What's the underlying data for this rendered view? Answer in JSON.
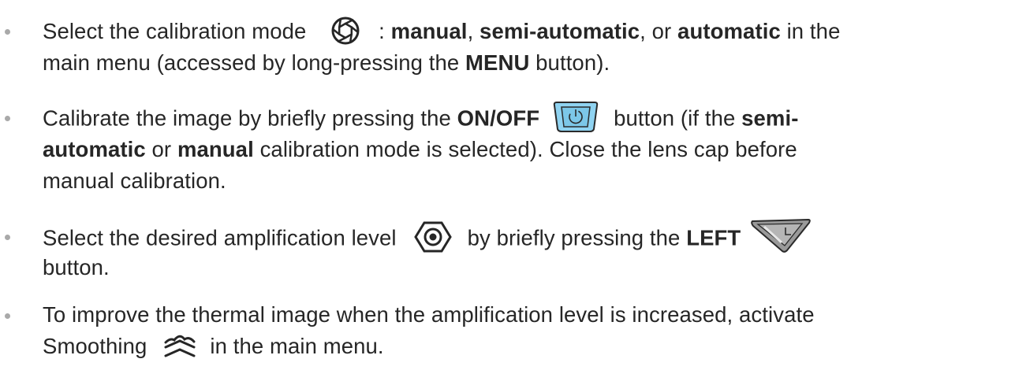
{
  "instructions": {
    "item1": {
      "t1": "Select the ",
      "t2": "calibration mode",
      "t3": " : ",
      "t4": "manual",
      "t5": ", ",
      "t6": "semi-automatic",
      "t7": ", or ",
      "t8": "automatic",
      "t9": " in the",
      "t10": "main menu (accessed by long-pressing the ",
      "t11": "MENU",
      "t12": " button).",
      "icon": "calibration-mode-icon"
    },
    "item2": {
      "t1": "Calibrate the image by briefly pressing the ",
      "t2": "ON/OFF",
      "t3": "button (if the ",
      "t4": "semi-",
      "t5": "automatic",
      "t6": " or ",
      "t7": "manual",
      "t8": " calibration mode is selected). Close the lens cap before",
      "t9": "manual calibration.",
      "icon": "power-button-icon"
    },
    "item3": {
      "t1": "Select the desired ",
      "t2": "amplification level",
      "t3": "by briefly pressing the ",
      "t4": "LEFT",
      "t5": "button.",
      "icon1": "amplification-level-icon",
      "icon2": "left-button-icon"
    },
    "item4": {
      "t1": "To improve the thermal image when the amplification level is increased, activate",
      "t2": "Smoothing",
      "t3": "in the main menu.",
      "icon": "smoothing-icon"
    }
  },
  "colors": {
    "text": "#262626",
    "bullet": "#a9a9a9",
    "power_button_fill": "#8fd3f1",
    "power_button_stroke": "#2a2a2a",
    "left_button_fill": "#9a9a9a"
  }
}
